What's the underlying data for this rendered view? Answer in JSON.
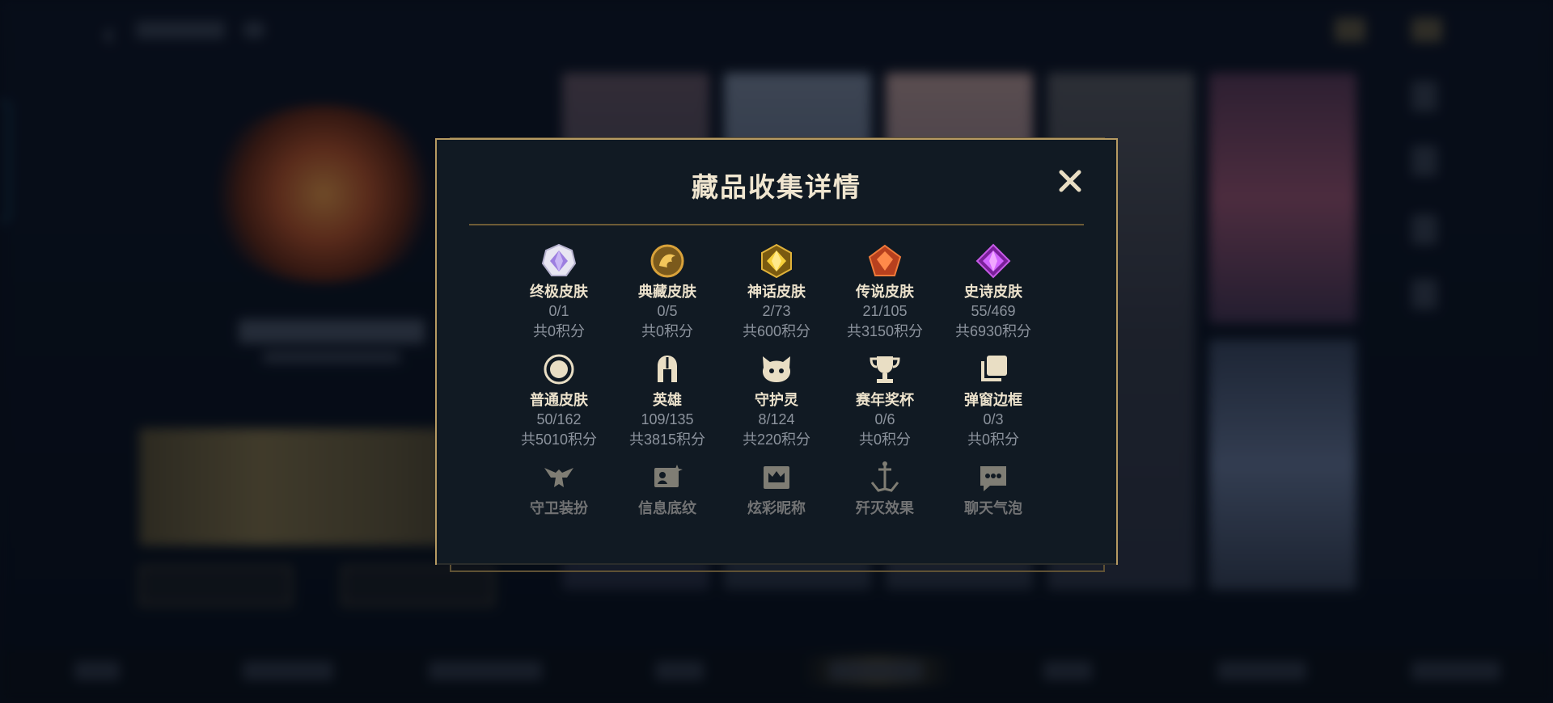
{
  "modal": {
    "title": "藏品收集详情",
    "close_label": "×"
  },
  "collections": [
    {
      "icon": "ultimate-skin-icon",
      "name": "终极皮肤",
      "count": "0/1",
      "points": "共0积分"
    },
    {
      "icon": "legacy-skin-icon",
      "name": "典藏皮肤",
      "count": "0/5",
      "points": "共0积分"
    },
    {
      "icon": "mythic-skin-icon",
      "name": "神话皮肤",
      "count": "2/73",
      "points": "共600积分"
    },
    {
      "icon": "legendary-skin-icon",
      "name": "传说皮肤",
      "count": "21/105",
      "points": "共3150积分"
    },
    {
      "icon": "epic-skin-icon",
      "name": "史诗皮肤",
      "count": "55/469",
      "points": "共6930积分"
    },
    {
      "icon": "common-skin-icon",
      "name": "普通皮肤",
      "count": "50/162",
      "points": "共5010积分"
    },
    {
      "icon": "champion-helmet-icon",
      "name": "英雄",
      "count": "109/135",
      "points": "共3815积分"
    },
    {
      "icon": "guardian-pet-icon",
      "name": "守护灵",
      "count": "8/124",
      "points": "共220积分"
    },
    {
      "icon": "trophy-icon",
      "name": "赛年奖杯",
      "count": "0/6",
      "points": "共0积分"
    },
    {
      "icon": "popup-frame-icon",
      "name": "弹窗边框",
      "count": "0/3",
      "points": "共0积分"
    },
    {
      "icon": "guardian-outfit-icon",
      "name": "守卫装扮"
    },
    {
      "icon": "profile-banner-icon",
      "name": "信息底纹"
    },
    {
      "icon": "colorful-nickname-icon",
      "name": "炫彩昵称"
    },
    {
      "icon": "kill-effect-icon",
      "name": "歼灭效果"
    },
    {
      "icon": "chat-bubble-icon",
      "name": "聊天气泡"
    }
  ],
  "colors": {
    "accent_gold": "#b69a62",
    "panel_bg": "#111a23",
    "title_text": "#f0e6d0",
    "muted_text": "#8c939d"
  }
}
